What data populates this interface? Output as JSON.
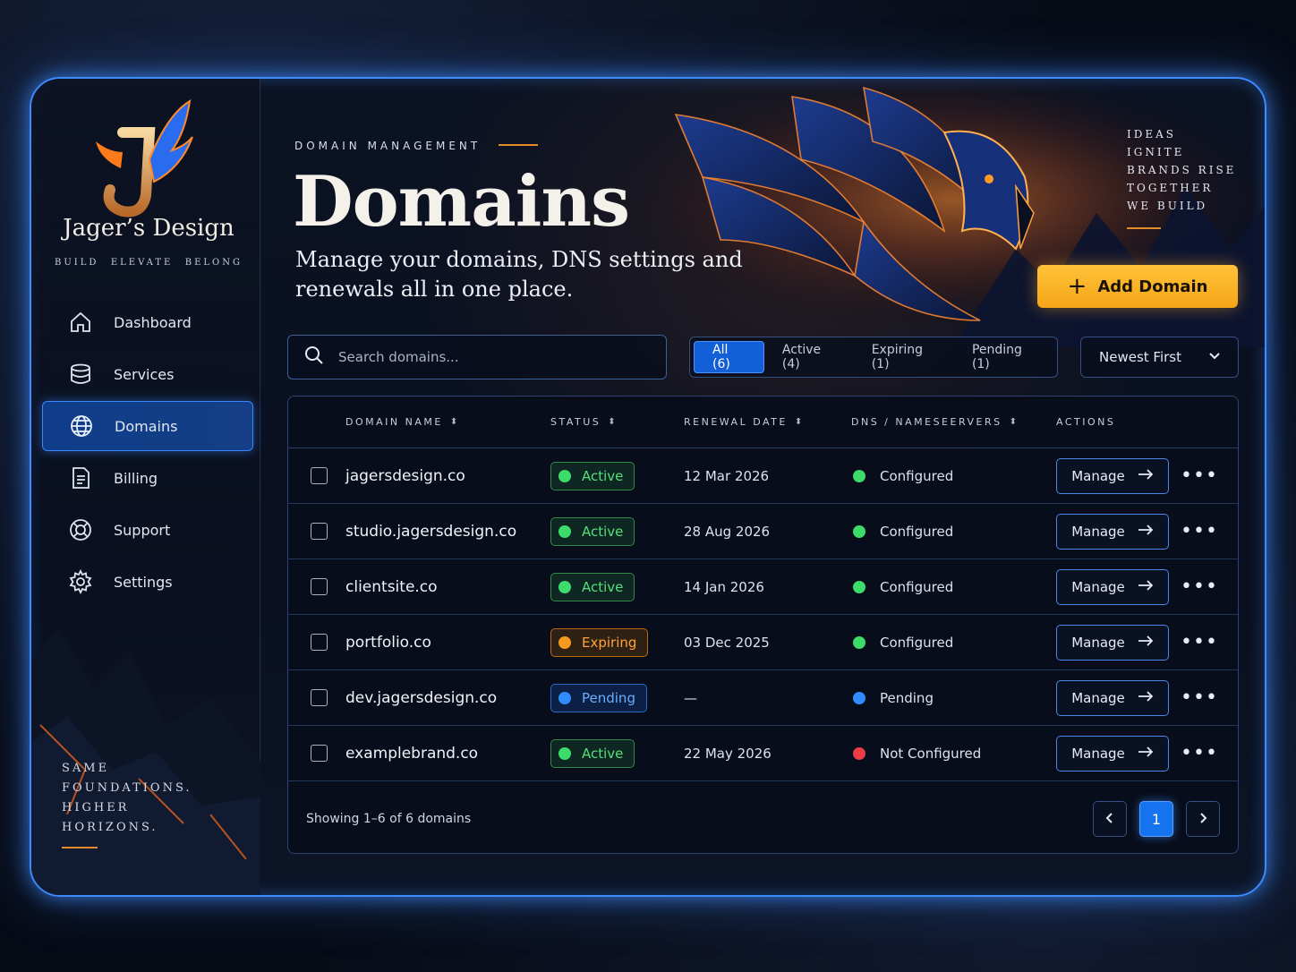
{
  "colors": {
    "accent": "#3e8bff",
    "brand_orange": "#e38a2a",
    "cta": "#f7b024",
    "active_green": "#3ddc6a",
    "expiring_orange": "#f59a1e",
    "pending_blue": "#2f8dff",
    "error_red": "#ee3b47"
  },
  "brand": {
    "name": "Jager’s Design",
    "tagline": [
      "BUILD",
      "ELEVATE",
      "BELONG"
    ],
    "logo_icon": "phoenix-j-logo"
  },
  "sidebar": {
    "items": [
      {
        "label": "Dashboard",
        "icon": "home-icon"
      },
      {
        "label": "Services",
        "icon": "database-icon"
      },
      {
        "label": "Domains",
        "icon": "globe-icon",
        "active": true
      },
      {
        "label": "Billing",
        "icon": "document-icon"
      },
      {
        "label": "Support",
        "icon": "lifebuoy-icon"
      },
      {
        "label": "Settings",
        "icon": "gear-icon"
      }
    ],
    "slogan": [
      "SAME",
      "FOUNDATIONS.",
      "HIGHER",
      "HORIZONS."
    ]
  },
  "header": {
    "eyebrow": "DOMAIN MANAGEMENT",
    "title": "Domains",
    "subtitle": "Manage your domains, DNS settings and renewals all in one place.",
    "quote": [
      "IDEAS",
      "IGNITE",
      "BRANDS RISE",
      "TOGETHER",
      "WE BUILD"
    ],
    "add_button": "Add Domain"
  },
  "search": {
    "placeholder": "Search domains..."
  },
  "filters": [
    {
      "label": "All (6)",
      "active": true
    },
    {
      "label": "Active (4)"
    },
    {
      "label": "Expiring (1)"
    },
    {
      "label": "Pending (1)"
    }
  ],
  "sort": {
    "selected": "Newest First"
  },
  "table": {
    "columns": [
      "DOMAIN NAME",
      "STATUS",
      "RENEWAL DATE",
      "DNS / NAMESEERVERS",
      "ACTIONS"
    ],
    "rows": [
      {
        "domain": "jagersdesign.co",
        "status": "Active",
        "status_type": "active",
        "renewal": "12 Mar 2026",
        "dns": "Configured",
        "dns_type": "ok",
        "action": "Manage"
      },
      {
        "domain": "studio.jagersdesign.co",
        "status": "Active",
        "status_type": "active",
        "renewal": "28 Aug 2026",
        "dns": "Configured",
        "dns_type": "ok",
        "action": "Manage"
      },
      {
        "domain": "clientsite.co",
        "status": "Active",
        "status_type": "active",
        "renewal": "14 Jan 2026",
        "dns": "Configured",
        "dns_type": "ok",
        "action": "Manage"
      },
      {
        "domain": "portfolio.co",
        "status": "Expiring",
        "status_type": "expiring",
        "renewal": "03 Dec 2025",
        "dns": "Configured",
        "dns_type": "ok",
        "action": "Manage"
      },
      {
        "domain": "dev.jagersdesign.co",
        "status": "Pending",
        "status_type": "pending",
        "renewal": "—",
        "dns": "Pending",
        "dns_type": "pending",
        "action": "Manage"
      },
      {
        "domain": "examplebrand.co",
        "status": "Active",
        "status_type": "active",
        "renewal": "22 May 2026",
        "dns": "Not Configured",
        "dns_type": "error",
        "action": "Manage"
      }
    ],
    "footer": "Showing 1–6 of 6 domains",
    "pagination": {
      "current": "1",
      "prev_icon": "chevron-left-icon",
      "next_icon": "chevron-right-icon"
    }
  }
}
